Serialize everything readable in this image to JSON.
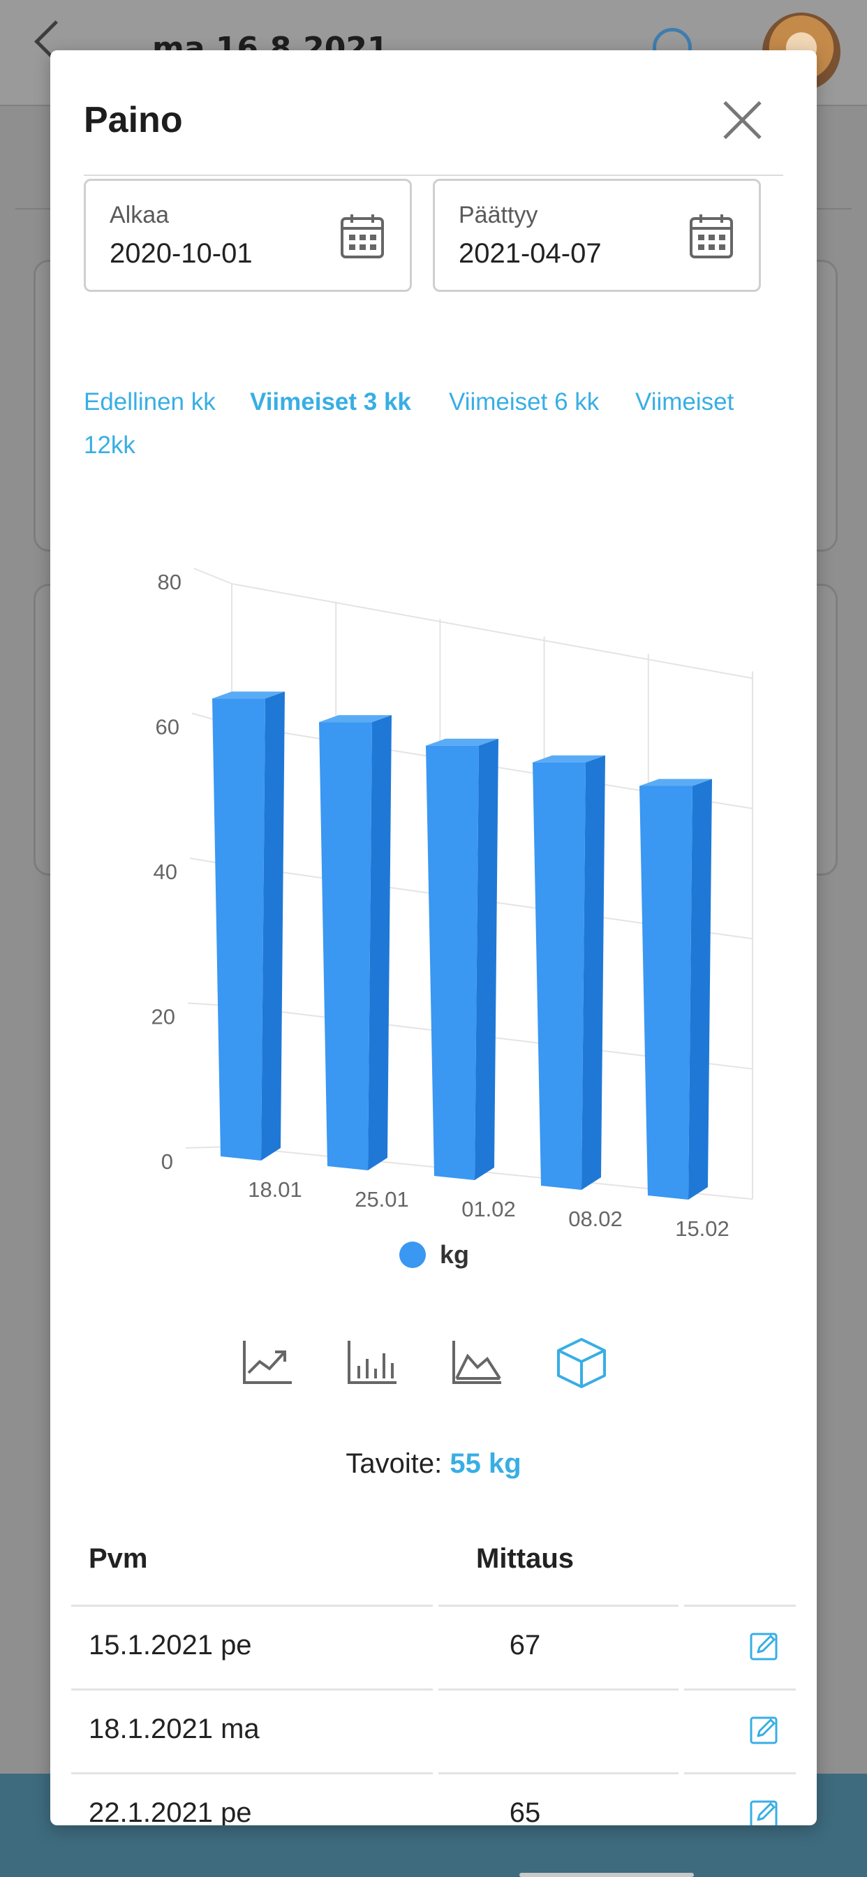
{
  "background": {
    "header_date": "ma 16.8.2021"
  },
  "modal": {
    "title": "Paino"
  },
  "date_range": {
    "start": {
      "label": "Alkaa",
      "value": "2020-10-01"
    },
    "end": {
      "label": "Päättyy",
      "value": "2021-04-07"
    }
  },
  "range_options": [
    {
      "label": "Edellinen kk",
      "active": false
    },
    {
      "label": "Viimeiset 3 kk",
      "active": true
    },
    {
      "label": "Viimeiset 6 kk",
      "active": false
    },
    {
      "label": "Viimeiset",
      "active": false
    },
    {
      "label": "12kk",
      "active": false
    }
  ],
  "chart_data": {
    "type": "bar",
    "style": "3d-column",
    "categories": [
      "18.01",
      "25.01",
      "01.02",
      "08.02",
      "15.02"
    ],
    "series": [
      {
        "name": "kg",
        "values": [
          67,
          65,
          63,
          62,
          60
        ],
        "color": "#3a97f2"
      }
    ],
    "ylim": [
      0,
      80
    ],
    "yticks": [
      "0",
      "20",
      "40",
      "60",
      "80"
    ],
    "grid": true,
    "legend": "bottom-center"
  },
  "chart_types": [
    {
      "icon": "line-chart-icon",
      "active": false
    },
    {
      "icon": "bar-chart-icon",
      "active": false
    },
    {
      "icon": "area-chart-icon",
      "active": false
    },
    {
      "icon": "3d-cube-icon",
      "active": true
    }
  ],
  "goal": {
    "label": "Tavoite:",
    "value": "55 kg"
  },
  "table": {
    "headers": {
      "date": "Pvm",
      "value": "Mittaus"
    },
    "rows": [
      {
        "date": "15.1.2021 pe",
        "value": "67"
      },
      {
        "date": "18.1.2021 ma",
        "value": ""
      },
      {
        "date": "22.1.2021 pe",
        "value": "65"
      }
    ]
  },
  "colors": {
    "accent": "#38aee4",
    "bar": "#3a97f2"
  }
}
